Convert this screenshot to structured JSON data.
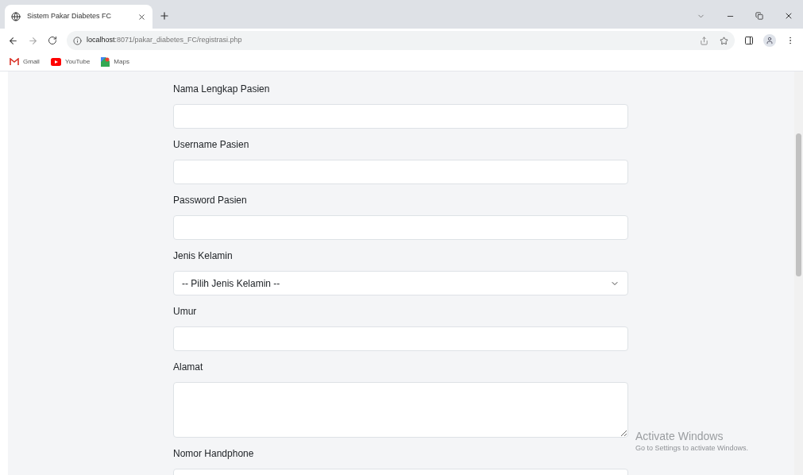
{
  "browser": {
    "tab_title": "Sistem Pakar Diabetes FC",
    "url_host": "localhost",
    "url_path": ":8071/pakar_diabetes_FC/registrasi.php",
    "bookmarks": [
      {
        "label": "Gmail",
        "kind": "gmail"
      },
      {
        "label": "YouTube",
        "kind": "youtube"
      },
      {
        "label": "Maps",
        "kind": "maps"
      }
    ]
  },
  "form": {
    "fields": [
      {
        "label": "Nama Lengkap Pasien",
        "kind": "text"
      },
      {
        "label": "Username Pasien",
        "kind": "text"
      },
      {
        "label": "Password Pasien",
        "kind": "text"
      },
      {
        "label": "Jenis Kelamin",
        "kind": "select",
        "value": "-- Pilih Jenis Kelamin --"
      },
      {
        "label": "Umur",
        "kind": "text"
      },
      {
        "label": "Alamat",
        "kind": "textarea"
      },
      {
        "label": "Nomor Handphone",
        "kind": "text"
      }
    ]
  },
  "os_notice": {
    "title": "Activate Windows",
    "text": "Go to Settings to activate Windows."
  }
}
